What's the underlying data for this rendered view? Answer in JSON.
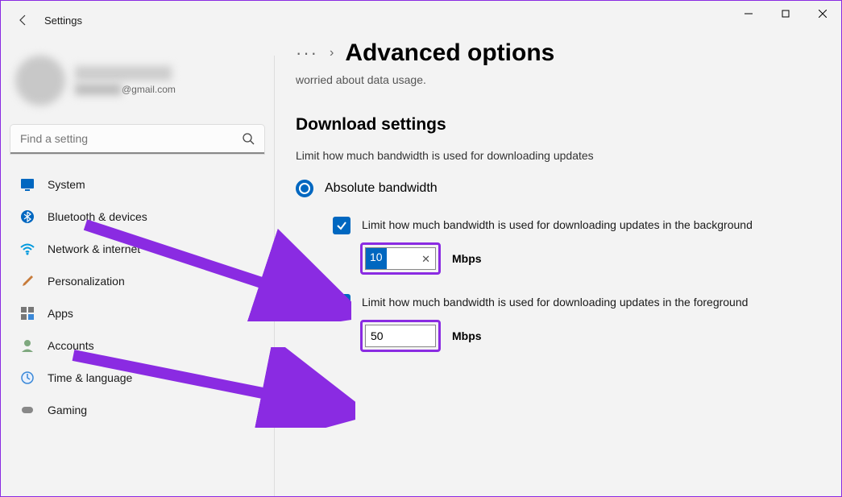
{
  "window": {
    "title": "Settings"
  },
  "user": {
    "email_suffix": "@gmail.com"
  },
  "search": {
    "placeholder": "Find a setting"
  },
  "nav": [
    {
      "id": "system",
      "label": "System"
    },
    {
      "id": "bluetooth",
      "label": "Bluetooth & devices"
    },
    {
      "id": "network",
      "label": "Network & internet"
    },
    {
      "id": "personalization",
      "label": "Personalization"
    },
    {
      "id": "apps",
      "label": "Apps"
    },
    {
      "id": "accounts",
      "label": "Accounts"
    },
    {
      "id": "time",
      "label": "Time & language"
    },
    {
      "id": "gaming",
      "label": "Gaming"
    }
  ],
  "page": {
    "breadcrumb_title": "Advanced options",
    "clipped_text": "worried about data usage.",
    "section_title": "Download settings",
    "section_sub": "Limit how much bandwidth is used for downloading updates",
    "radio_label": "Absolute bandwidth",
    "bg_check_label": "Limit how much bandwidth is used for downloading updates in the background",
    "fg_check_label": "Limit how much bandwidth is used for downloading updates in the foreground",
    "bg_value": "10",
    "fg_value": "50",
    "unit": "Mbps"
  },
  "colors": {
    "accent": "#0067c0",
    "highlight": "#8a2be2"
  }
}
